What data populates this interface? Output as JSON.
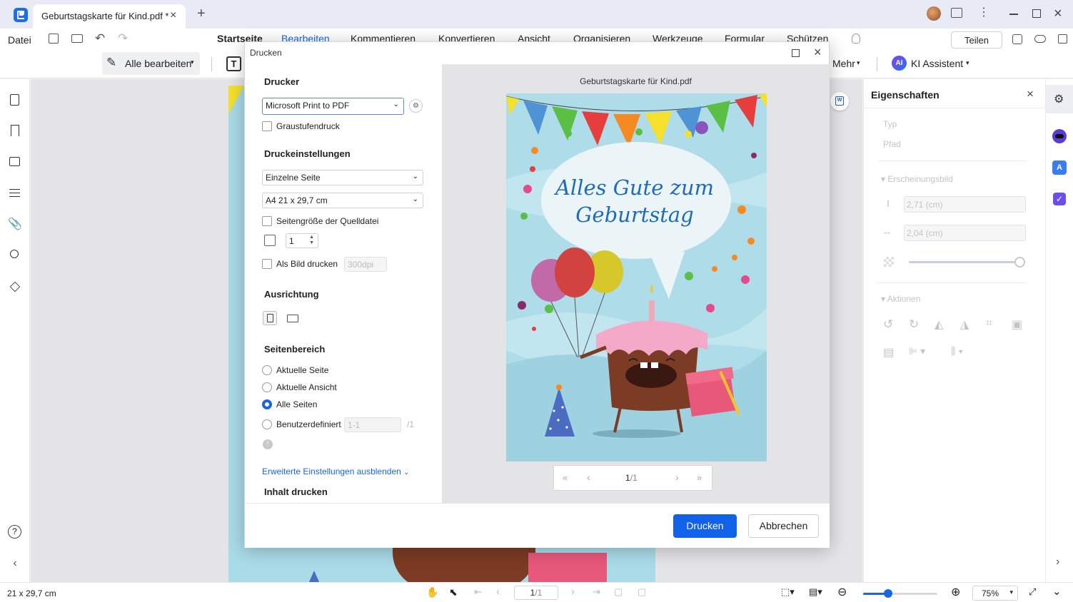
{
  "window": {
    "tab_title": "Geburtstagskarte für Kind.pdf *",
    "new_tab": "+",
    "close_tab": "×"
  },
  "menu": {
    "datei": "Datei",
    "items": [
      "Startseite",
      "Bearbeiten",
      "Kommentieren",
      "Konvertieren",
      "Ansicht",
      "Organisieren",
      "Werkzeuge",
      "Formular",
      "Schützen"
    ],
    "active": "Bearbeiten",
    "share": "Teilen"
  },
  "toolbar": {
    "edit_all": "Alle bearbeiten",
    "mehr": "Mehr",
    "ai_badge": "AI",
    "ai_label": "KI Assistent"
  },
  "dialog": {
    "title": "Drucken",
    "printer": {
      "title": "Drucker",
      "selected": "Microsoft Print to PDF",
      "grayscale": "Graustufendruck"
    },
    "settings": {
      "title": "Druckeinstellungen",
      "page_mode": "Einzelne Seite",
      "paper": "A4 21 x 29,7 cm",
      "source_size": "Seitengröße der Quelldatei",
      "copies": "1",
      "as_image": "Als Bild drucken",
      "dpi": "300dpi"
    },
    "orientation": {
      "title": "Ausrichtung"
    },
    "range": {
      "title": "Seitenbereich",
      "current_page": "Aktuelle Seite",
      "current_view": "Aktuelle Ansicht",
      "all_pages": "Alle Seiten",
      "custom": "Benutzerdefiniert",
      "custom_value": "1-1",
      "total": "/1",
      "selected": "all_pages"
    },
    "advanced_link": "Erweiterte Einstellungen ausblenden",
    "next_section": "Inhalt drucken",
    "preview": {
      "filename": "Geburtstagskarte für Kind.pdf",
      "card_line1": "Alles Gute zum",
      "card_line2": "Geburtstag",
      "page_current": "1",
      "page_total": "/1"
    },
    "print_button": "Drucken",
    "cancel_button": "Abbrechen"
  },
  "properties": {
    "title": "Eigenschaften",
    "typ": "Typ",
    "pfad": "Pfad",
    "appearance": "Erscheinungsbild",
    "height": "2,71 (cm)",
    "width": "2,04 (cm)",
    "opacity": 1.0,
    "actions": "Aktionen"
  },
  "statusbar": {
    "page_size": "21 x 29,7 cm",
    "page": "1",
    "page_total": "/1",
    "zoom": "75%",
    "zoom_level": 0.34
  },
  "colors": {
    "accent": "#1866e0",
    "card_bg": "#a9dce8",
    "title_text": "#1f6bb5",
    "print_btn": "#1162e8"
  }
}
